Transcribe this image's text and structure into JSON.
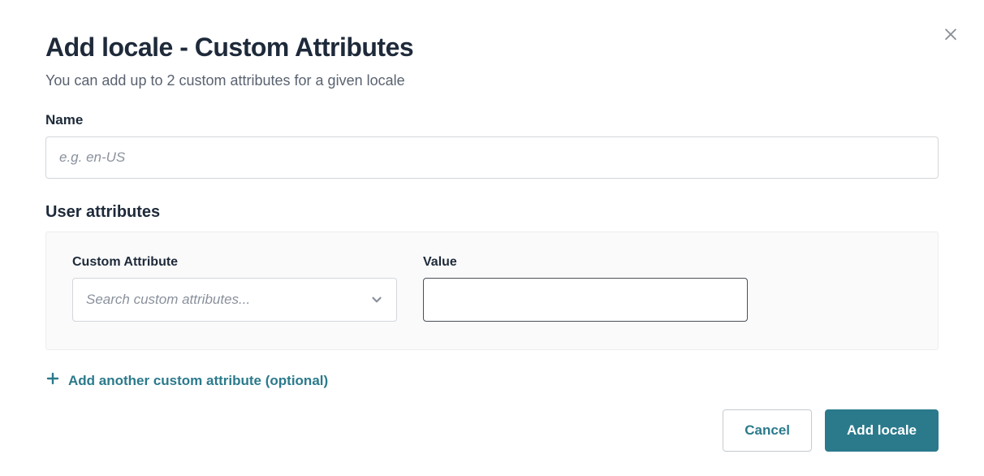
{
  "modal": {
    "title": "Add locale - Custom Attributes",
    "subtitle": "You can add up to 2 custom attributes for a given locale"
  },
  "name_field": {
    "label": "Name",
    "placeholder": "e.g. en-US",
    "value": ""
  },
  "user_attributes": {
    "heading": "User attributes",
    "custom_attribute": {
      "label": "Custom Attribute",
      "placeholder": "Search custom attributes...",
      "value": ""
    },
    "value_field": {
      "label": "Value",
      "value": ""
    }
  },
  "add_link": {
    "label": "Add another custom attribute (optional)"
  },
  "footer": {
    "cancel": "Cancel",
    "submit": "Add locale"
  }
}
